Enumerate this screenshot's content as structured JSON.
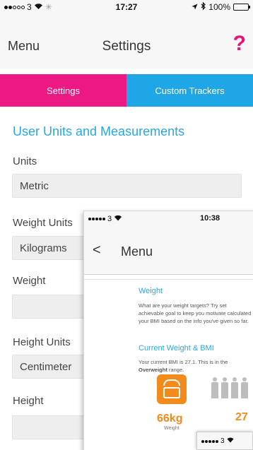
{
  "status_bar": {
    "carrier": "3",
    "time": "17:27",
    "battery": "100%"
  },
  "nav": {
    "menu_label": "Menu",
    "title": "Settings",
    "help_label": "?"
  },
  "tabs": [
    {
      "label": "Settings",
      "active": true
    },
    {
      "label": "Custom Trackers",
      "active": false
    }
  ],
  "section_title": "User Units and Measurements",
  "form": {
    "units_label": "Units",
    "units_value": "Metric",
    "weight_units_label": "Weight Units",
    "weight_units_value": "Kilograms",
    "weight_label": "Weight",
    "weight_value": "",
    "height_units_label": "Height Units",
    "height_units_value": "Centimeter",
    "height_label": "Height",
    "height_value": ""
  },
  "overlay": {
    "status_carrier": "3",
    "status_time": "10:38",
    "back_label": "<",
    "menu_label": "Menu",
    "weight_heading": "Weight",
    "weight_text": "What are your weight targets? Try set achievable goal to keep you motivate calculated your BMI based on the info you've given so far.",
    "bmi_heading": "Current Weight & BMI",
    "bmi_text_prefix": "Your current BMI is 27.1. This is in the",
    "bmi_text_bold": "Overweight",
    "bmi_text_suffix": " range.",
    "weight_value": "66kg",
    "weight_caption": "Weight",
    "bmi_value": "27",
    "mini_status_carrier": "3"
  },
  "colors": {
    "accent_pink": "#ec1883",
    "accent_blue": "#1ea6e7",
    "orange": "#f28a1c"
  },
  "icons": [
    "signal-dots-icon",
    "wifi-icon",
    "location-arrow-icon",
    "bluetooth-icon",
    "battery-icon",
    "help-icon",
    "back-chevron-icon",
    "scale-icon",
    "people-icon"
  ]
}
